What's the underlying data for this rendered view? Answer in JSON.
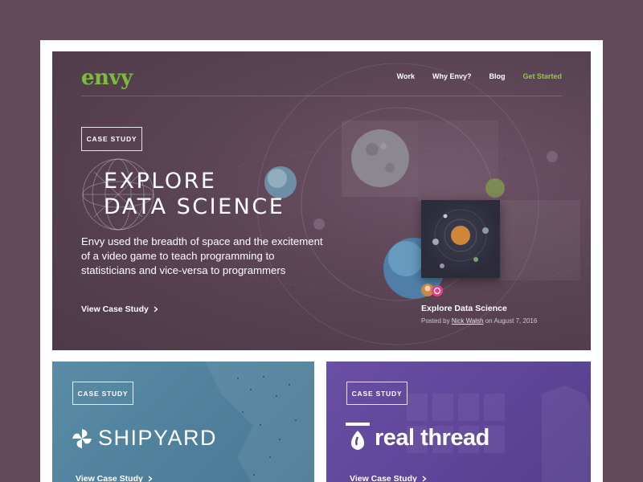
{
  "brand": {
    "logo_text": "envy",
    "accent_color": "#7dbb3c"
  },
  "nav": {
    "items": [
      {
        "label": "Work"
      },
      {
        "label": "Why Envy?"
      },
      {
        "label": "Blog"
      },
      {
        "label": "Get Started",
        "accent": true
      }
    ]
  },
  "hero": {
    "badge": "CASE STUDY",
    "title_line1": "EXPLORE",
    "title_line2": "DATA SCIENCE",
    "description": "Envy used the breadth of space and the excitement of a video game to teach programming to statisticians and vice-versa to programmers",
    "cta": "View Case Study",
    "cta_icon": "chevron-right-icon",
    "post": {
      "title": "Explore Data Science",
      "posted_by_prefix": "Posted by",
      "author": "Nick Walsh",
      "date_text": "on August 7, 2016"
    }
  },
  "cards": [
    {
      "badge": "CASE STUDY",
      "logo_text": "SHIPYARD",
      "cta": "View Case Study",
      "background": "#5a8ca6"
    },
    {
      "badge": "CASE STUDY",
      "logo_text": "real thread",
      "cta": "View Case Study",
      "background": "#6a4fa4"
    }
  ]
}
